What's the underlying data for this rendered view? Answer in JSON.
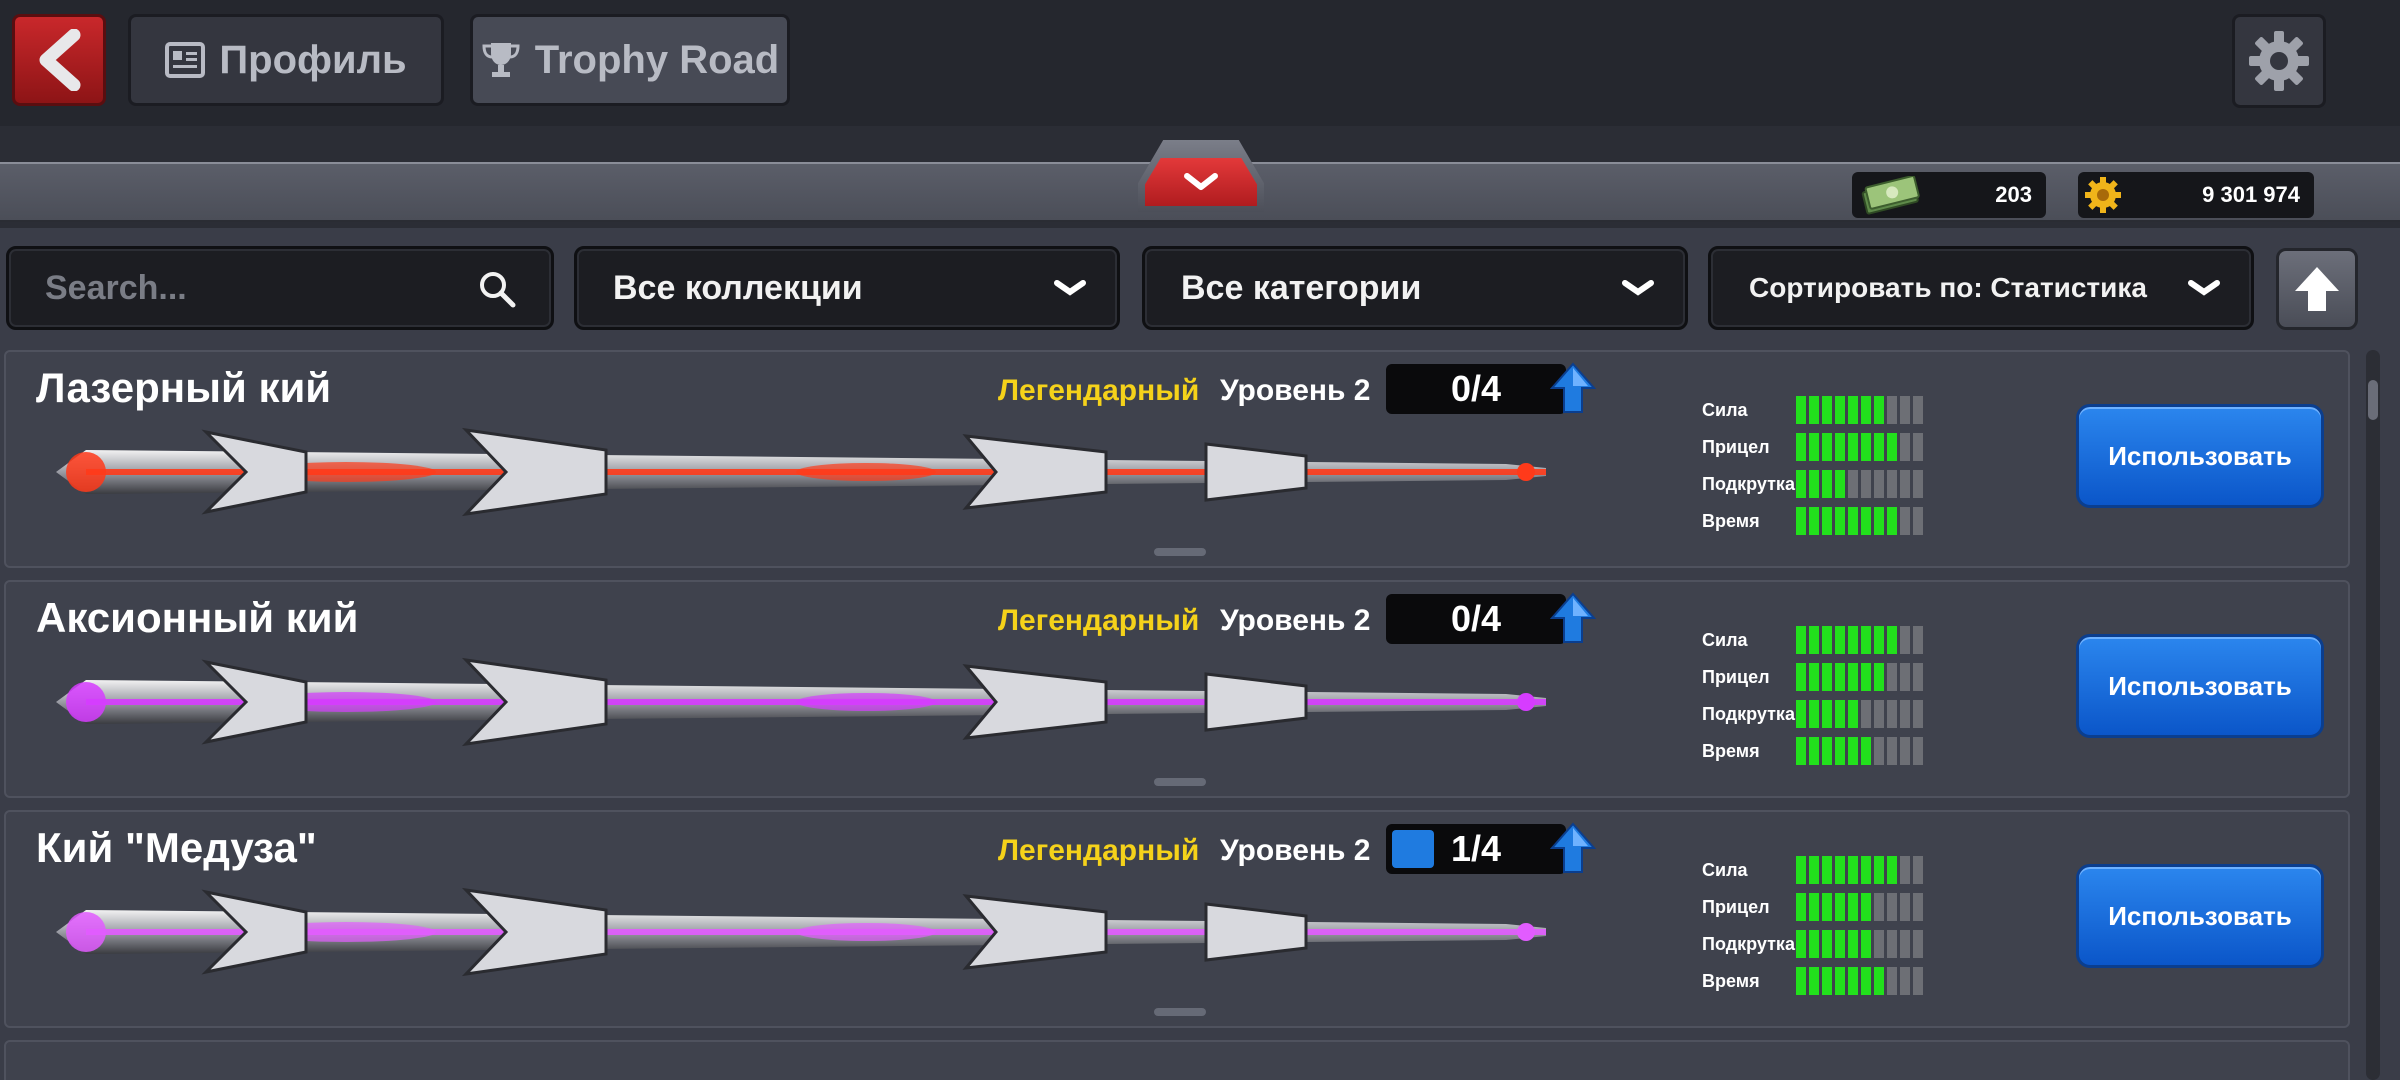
{
  "nav": {
    "profile_label": "Профиль",
    "trophy_label": "Trophy Road"
  },
  "currency": {
    "cash": "203",
    "coins": "9 301 974"
  },
  "filters": {
    "search_placeholder": "Search...",
    "collections": "Все коллекции",
    "categories": "Все категории",
    "sort": "Сортировать по: Статистика"
  },
  "stat_labels": [
    "Сила",
    "Прицел",
    "Подкрутка",
    "Время"
  ],
  "cues": [
    {
      "name": "Лазерный кий",
      "rarity": "Легендарный",
      "level": "Уровень 2",
      "progress": "0/4",
      "progress_fraction": 0,
      "stats": [
        7,
        8,
        4,
        8
      ],
      "use_label": "Использовать",
      "accent": "#ff3a1a"
    },
    {
      "name": "Аксионный кий",
      "rarity": "Легендарный",
      "level": "Уровень 2",
      "progress": "0/4",
      "progress_fraction": 0,
      "stats": [
        8,
        7,
        5,
        6
      ],
      "use_label": "Использовать",
      "accent": "#d63cff"
    },
    {
      "name": "Кий \"Медуза\"",
      "rarity": "Легендарный",
      "level": "Уровень 2",
      "progress": "1/4",
      "progress_fraction": 0.25,
      "stats": [
        8,
        6,
        6,
        7
      ],
      "use_label": "Использовать",
      "accent": "#e25cff"
    }
  ],
  "colors": {
    "rarity": "#f5d21a",
    "stat_on": "#22e01c",
    "stat_off": "#6d6f75",
    "use_button": "#1b6fe0"
  }
}
